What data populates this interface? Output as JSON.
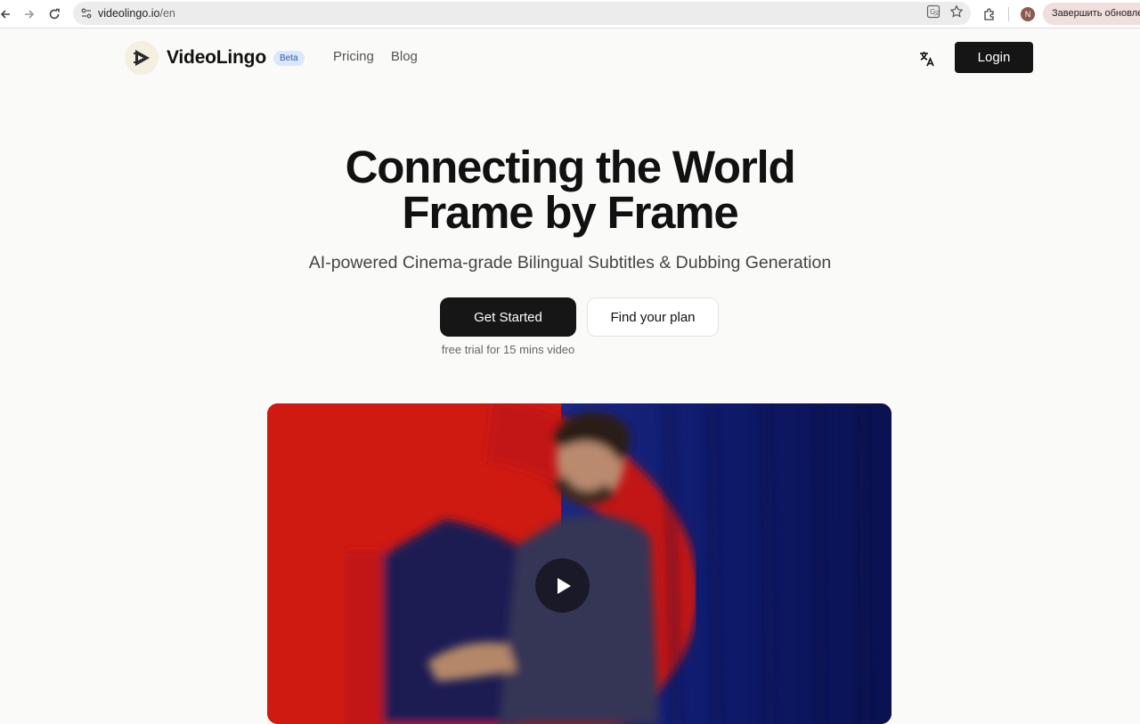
{
  "browser": {
    "url_host": "videolingo.io",
    "url_path": "/en",
    "avatar_letter": "N",
    "update_label": "Завершить обновле"
  },
  "header": {
    "brand": "VideoLingo",
    "badge": "Beta",
    "nav": [
      "Pricing",
      "Blog"
    ],
    "login_label": "Login"
  },
  "hero": {
    "title_line1": "Connecting the World",
    "title_line2": "Frame by Frame",
    "subtitle": "AI-powered Cinema-grade Bilingual Subtitles & Dubbing Generation",
    "primary_cta": "Get Started",
    "secondary_cta": "Find your plan",
    "trial_note": "free trial for 15 mins video"
  },
  "colors": {
    "page_bg": "#fafaf9",
    "primary_button": "#161616",
    "beta_bg": "#dbe7fb",
    "beta_text": "#2b5bb8"
  }
}
